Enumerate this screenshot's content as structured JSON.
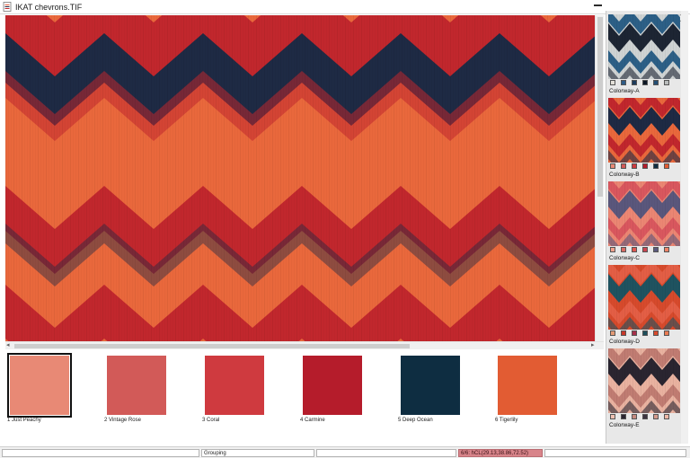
{
  "window": {
    "title": "IKAT chevrons.TIF"
  },
  "colors": {
    "coral_ground": "#e9683c",
    "carmine": "#c1272d",
    "deep_ocean": "#1e2a44"
  },
  "palette": [
    {
      "label": "1 Just Peachy",
      "color": "#e88975",
      "selected": true
    },
    {
      "label": "2 Vintage Rose",
      "color": "#d25a58",
      "selected": false
    },
    {
      "label": "3 Coral",
      "color": "#cf3a3f",
      "selected": false
    },
    {
      "label": "4 Carmine",
      "color": "#b51c2b",
      "selected": false
    },
    {
      "label": "5 Deep Ocean",
      "color": "#0e2d41",
      "selected": false
    },
    {
      "label": "6 Tigerlily",
      "color": "#e25c33",
      "selected": false
    }
  ],
  "colorways": [
    {
      "label": "Colorway-A",
      "ground": "#cfd3d3",
      "band": "#2c5f86",
      "dark": "#1d2533",
      "chips": [
        "#e3e0d8",
        "#2f5c86",
        "#1e3c5c",
        "#0c1624",
        "#244e74",
        "#b9bcbc"
      ]
    },
    {
      "label": "Colorway-B",
      "ground": "#e9683c",
      "band": "#c1272d",
      "dark": "#1e2a44",
      "chips": [
        "#e88975",
        "#d25a58",
        "#cf3a3f",
        "#b51c2b",
        "#0e2d41",
        "#e25c33"
      ]
    },
    {
      "label": "Colorway-C",
      "ground": "#eb8673",
      "band": "#d9575e",
      "dark": "#5a577c",
      "chips": [
        "#f0a08c",
        "#d86a62",
        "#e0574f",
        "#c94550",
        "#5b5a7e",
        "#ef8366"
      ]
    },
    {
      "label": "Colorway-D",
      "ground": "#d64a2c",
      "band": "#e35e45",
      "dark": "#1f5360",
      "chips": [
        "#e39a75",
        "#c8382a",
        "#a6304a",
        "#1d4e5b",
        "#d64a2c",
        "#ea7b52"
      ]
    },
    {
      "label": "Colorway-E",
      "ground": "#e9b2a0",
      "band": "#c07c72",
      "dark": "#2a2530",
      "chips": [
        "#efc1b2",
        "#2a2530",
        "#c58a7f",
        "#3c3340",
        "#d49a8c",
        "#efb7a6"
      ]
    }
  ],
  "status": {
    "field1": "Grouping",
    "field2": "6/6: hCL(29.13,38.86,72.52)"
  }
}
